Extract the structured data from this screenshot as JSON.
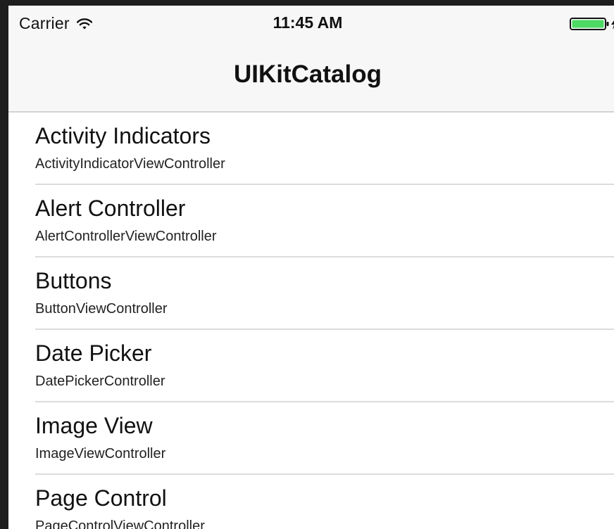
{
  "status_bar": {
    "carrier": "Carrier",
    "time": "11:45 AM",
    "wifi_icon": "wifi-icon",
    "battery_icon": "battery-charging-icon",
    "battery_color": "#4cd964"
  },
  "nav_bar": {
    "title": "UIKitCatalog"
  },
  "list": {
    "items": [
      {
        "title": "Activity Indicators",
        "subtitle": "ActivityIndicatorViewController"
      },
      {
        "title": "Alert Controller",
        "subtitle": "AlertControllerViewController"
      },
      {
        "title": "Buttons",
        "subtitle": "ButtonViewController"
      },
      {
        "title": "Date Picker",
        "subtitle": "DatePickerController"
      },
      {
        "title": "Image View",
        "subtitle": "ImageViewController"
      },
      {
        "title": "Page Control",
        "subtitle": "PageControlViewController"
      }
    ]
  }
}
